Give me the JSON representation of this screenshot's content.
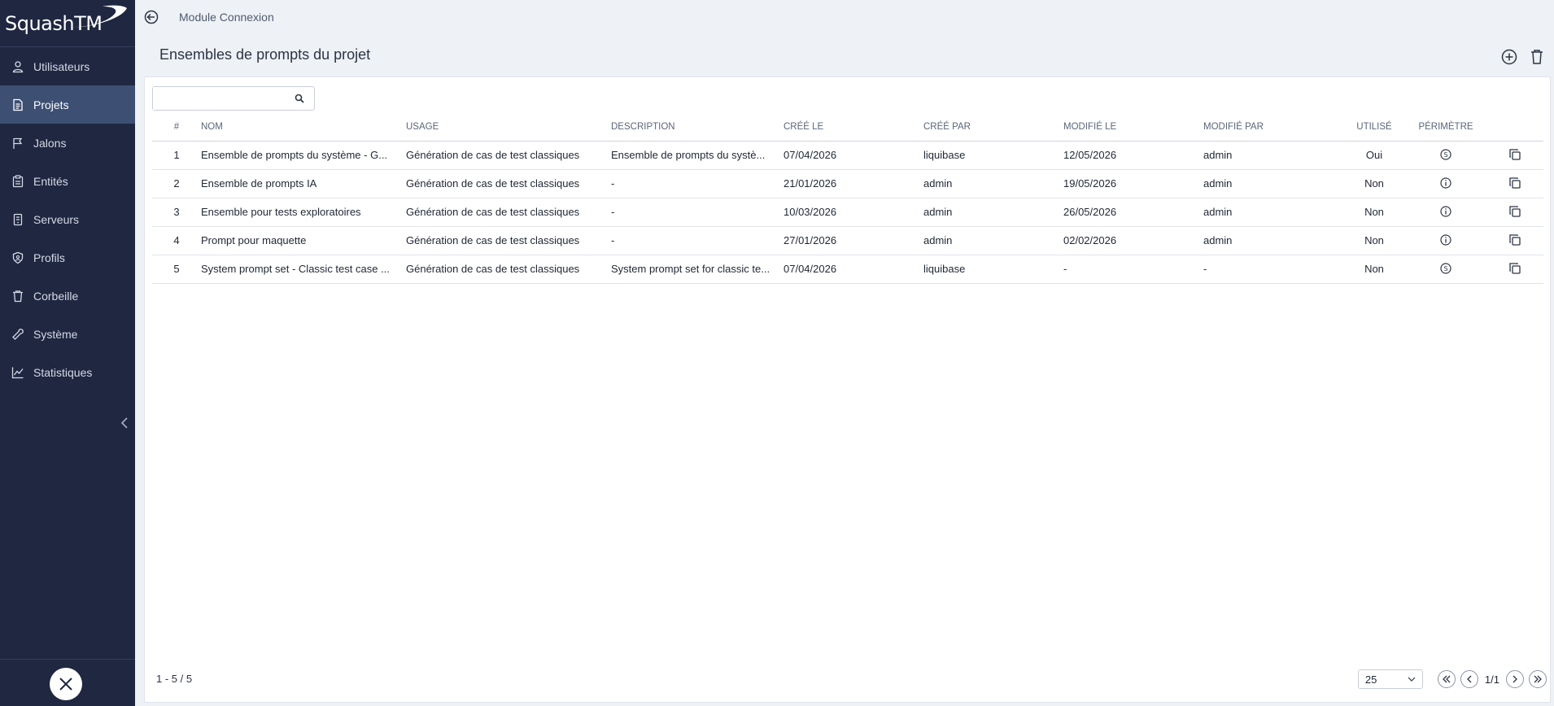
{
  "app": {
    "logo_text": "SquashTM"
  },
  "sidebar": {
    "items": [
      {
        "label": "Utilisateurs",
        "icon": "user-icon",
        "active": false
      },
      {
        "label": "Projets",
        "icon": "document-icon",
        "active": true
      },
      {
        "label": "Jalons",
        "icon": "flag-icon",
        "active": false
      },
      {
        "label": "Entités",
        "icon": "clipboard-icon",
        "active": false
      },
      {
        "label": "Serveurs",
        "icon": "server-icon",
        "active": false
      },
      {
        "label": "Profils",
        "icon": "shield-icon",
        "active": false
      },
      {
        "label": "Corbeille",
        "icon": "trash-icon",
        "active": false
      },
      {
        "label": "Système",
        "icon": "wrench-icon",
        "active": false
      },
      {
        "label": "Statistiques",
        "icon": "chart-icon",
        "active": false
      }
    ]
  },
  "header": {
    "module": "Module Connexion",
    "title": "Ensembles de prompts du projet"
  },
  "search": {
    "placeholder": ""
  },
  "table": {
    "columns": [
      "#",
      "NOM",
      "USAGE",
      "DESCRIPTION",
      "CRÉÉ LE",
      "CRÉÉ PAR",
      "MODIFIÉ LE",
      "MODIFIÉ PAR",
      "UTILISÉ",
      "PÉRIMÈTRE"
    ],
    "rows": [
      {
        "idx": "1",
        "nom": "Ensemble de prompts du système - G...",
        "usage": "Génération de cas de test classiques",
        "description": "Ensemble de prompts du systè...",
        "cree_le": "07/04/2026",
        "cree_par": "liquibase",
        "modifie_le": "12/05/2026",
        "modifie_par": "admin",
        "utilise": "Oui",
        "perimetre": "system"
      },
      {
        "idx": "2",
        "nom": "Ensemble de prompts IA",
        "usage": "Génération de cas de test classiques",
        "description": "-",
        "cree_le": "21/01/2026",
        "cree_par": "admin",
        "modifie_le": "19/05/2026",
        "modifie_par": "admin",
        "utilise": "Non",
        "perimetre": "info"
      },
      {
        "idx": "3",
        "nom": "Ensemble pour tests exploratoires",
        "usage": "Génération de cas de test classiques",
        "description": "-",
        "cree_le": "10/03/2026",
        "cree_par": "admin",
        "modifie_le": "26/05/2026",
        "modifie_par": "admin",
        "utilise": "Non",
        "perimetre": "info"
      },
      {
        "idx": "4",
        "nom": "Prompt pour maquette",
        "usage": "Génération de cas de test classiques",
        "description": "-",
        "cree_le": "27/01/2026",
        "cree_par": "admin",
        "modifie_le": "02/02/2026",
        "modifie_par": "admin",
        "utilise": "Non",
        "perimetre": "info"
      },
      {
        "idx": "5",
        "nom": "System prompt set - Classic test case ...",
        "usage": "Génération de cas de test classiques",
        "description": "System prompt set for classic te...",
        "cree_le": "07/04/2026",
        "cree_par": "liquibase",
        "modifie_le": "-",
        "modifie_par": "-",
        "utilise": "Non",
        "perimetre": "system"
      }
    ]
  },
  "footer": {
    "count": "1 - 5 / 5",
    "page_size": "25",
    "page_indicator": "1/1"
  }
}
